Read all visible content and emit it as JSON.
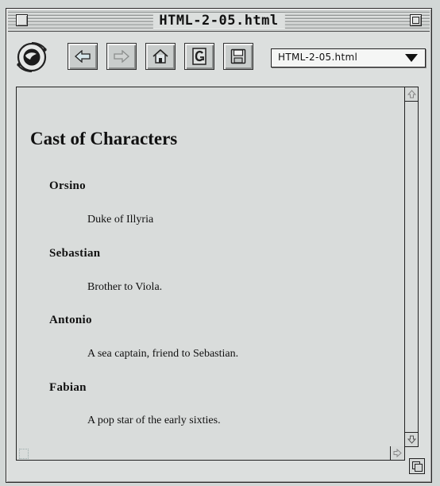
{
  "window": {
    "title": "HTML-2-05.html"
  },
  "toolbar": {
    "url_select_value": "HTML-2-05.html",
    "buttons": [
      {
        "name": "back-button",
        "icon": "left-arrow-icon"
      },
      {
        "name": "forward-button",
        "icon": "right-arrow-icon"
      },
      {
        "name": "home-button",
        "icon": "house-icon"
      },
      {
        "name": "reload-button",
        "icon": "reload-icon"
      },
      {
        "name": "save-button",
        "icon": "floppy-disk-icon"
      }
    ]
  },
  "page": {
    "heading": "Cast of Characters",
    "characters": [
      {
        "name": "Orsino",
        "description": "Duke of Illyria"
      },
      {
        "name": "Sebastian",
        "description": "Brother to Viola."
      },
      {
        "name": "Antonio",
        "description": "A sea captain, friend to Sebastian."
      },
      {
        "name": "Fabian",
        "description": "A pop star of the early sixties."
      }
    ]
  },
  "colors": {
    "window_bg": "#dcdfde",
    "content_bg": "#d9dcdb",
    "desktop_bg": "#d2d7d6",
    "text": "#111111"
  }
}
